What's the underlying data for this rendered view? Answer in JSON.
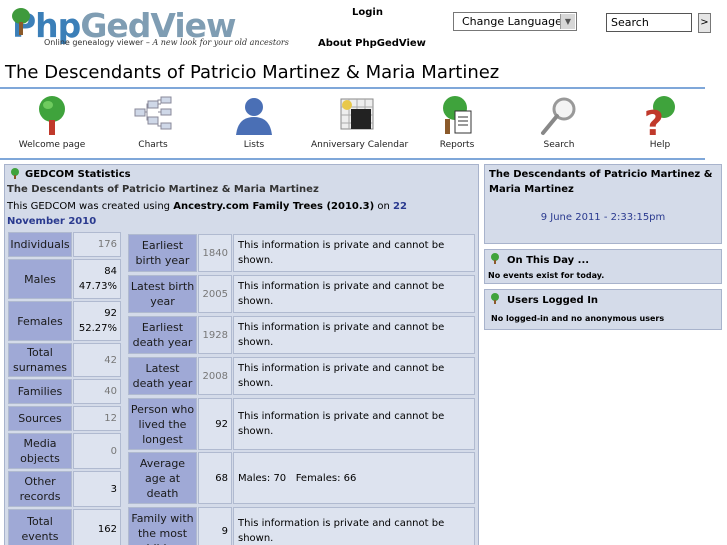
{
  "header": {
    "logo_text_1": "Php",
    "logo_text_2": "GedView",
    "tagline_1": "Online genealogy viewer –",
    "tagline_2": "A new look for your old ancestors",
    "login": "Login",
    "about": "About PhpGedView",
    "language_select": "Change Language",
    "search_placeholder": "Search",
    "search_go": ">"
  },
  "page_title": "The Descendants of Patricio Martinez & Maria Martinez",
  "menu": [
    {
      "label": "Welcome page",
      "icon": "tree-icon"
    },
    {
      "label": "Charts",
      "icon": "chart-icon"
    },
    {
      "label": "Lists",
      "icon": "person-icon"
    },
    {
      "label": "Anniversary Calendar",
      "icon": "calendar-icon"
    },
    {
      "label": "Reports",
      "icon": "report-icon"
    },
    {
      "label": "Search",
      "icon": "magnifier-icon"
    },
    {
      "label": "Help",
      "icon": "help-icon"
    }
  ],
  "stats": {
    "title": "GEDCOM Statistics",
    "subtitle": "The Descendants of Patricio Martinez & Maria Martinez",
    "created_prefix": "This GEDCOM was created using",
    "created_software": "Ancestry.com Family Trees (2010.3)",
    "created_on": "on",
    "created_date": "22 November 2010",
    "left_rows": [
      {
        "label": "Individuals",
        "value": "176"
      },
      {
        "label": "Males",
        "value": "84",
        "pct": "47.73%"
      },
      {
        "label": "Females",
        "value": "92",
        "pct": "52.27%"
      },
      {
        "label": "Total surnames",
        "value": "42"
      },
      {
        "label": "Families",
        "value": "40"
      },
      {
        "label": "Sources",
        "value": "12"
      },
      {
        "label": "Media objects",
        "value": "0"
      },
      {
        "label": "Other records",
        "value": "3"
      },
      {
        "label": "Total events",
        "value": "162"
      }
    ],
    "right_rows": [
      {
        "label": "Earliest birth year",
        "year": "1840",
        "info": "This information is private and cannot be shown."
      },
      {
        "label": "Latest birth year",
        "year": "2005",
        "info": "This information is private and cannot be shown."
      },
      {
        "label": "Earliest death year",
        "year": "1928",
        "info": "This information is private and cannot be shown."
      },
      {
        "label": "Latest death year",
        "year": "2008",
        "info": "This information is private and cannot be shown."
      },
      {
        "label": "Person who lived the longest",
        "year": "92",
        "info": "This information is private and cannot be shown."
      },
      {
        "label": "Average age at death",
        "year": "68",
        "info": "Males: 70   Females: 66"
      },
      {
        "label": "Family with the most children",
        "year": "9",
        "info": "This information is private and cannot be shown."
      }
    ]
  },
  "right_panel": {
    "title": "The Descendants of Patricio Martinez & Maria Martinez",
    "datetime": "9 June 2011 - 2:33:15pm",
    "on_this_day_title": "On This Day ...",
    "on_this_day_text": "No events exist for today.",
    "users_title": "Users Logged In",
    "users_text": "No logged-in and no anonymous users"
  },
  "colors": {
    "accent": "#7fa7d9",
    "panel_bg": "#d4dbe9",
    "label_bg": "#9fa9d6",
    "date_link": "#2a3a8f"
  }
}
